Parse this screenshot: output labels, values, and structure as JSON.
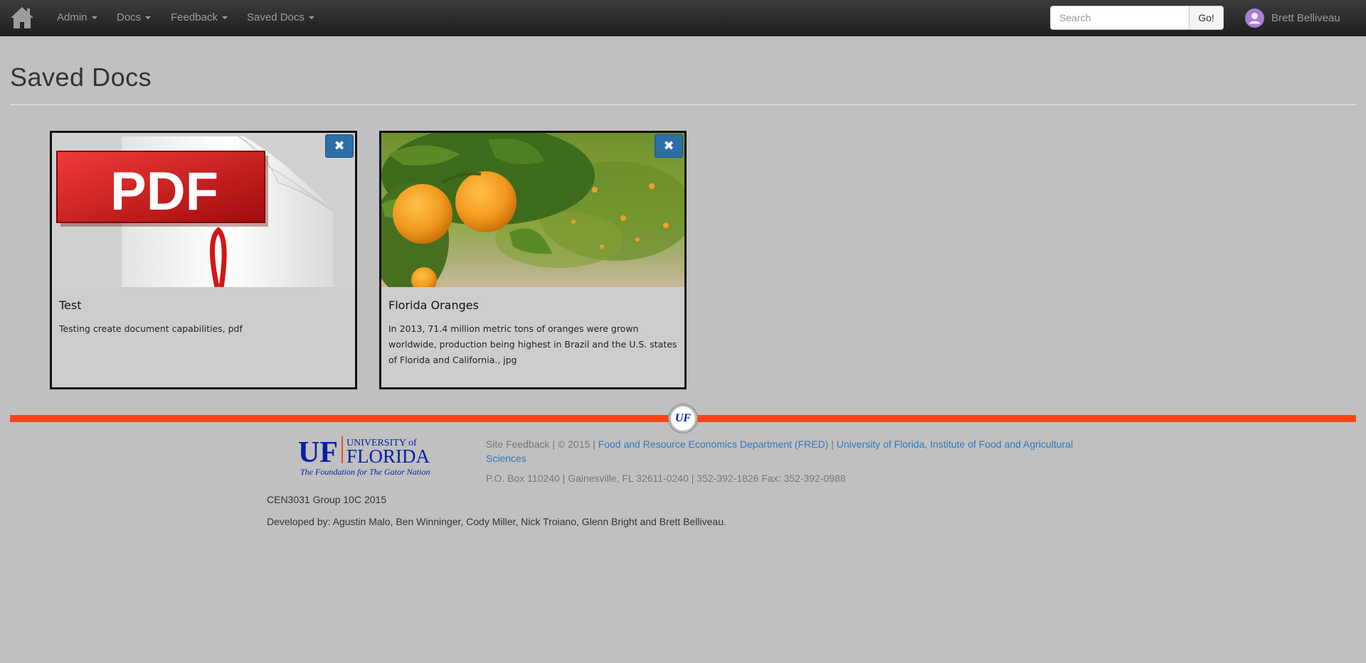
{
  "nav": {
    "menus": [
      {
        "label": "Admin"
      },
      {
        "label": "Docs"
      },
      {
        "label": "Feedback"
      },
      {
        "label": "Saved Docs"
      }
    ],
    "search_placeholder": "Search",
    "search_button": "Go!",
    "user_name": "Brett Belliveau"
  },
  "page": {
    "title": "Saved Docs"
  },
  "cards": [
    {
      "title": "Test",
      "description": "Testing create document capabilities, pdf",
      "thumbnail_icon": "pdf-document-icon",
      "thumbnail_text": "PDF",
      "remove_icon": "✖"
    },
    {
      "title": "Florida Oranges",
      "description": "In 2013, 71.4 million metric tons of oranges were grown worldwide, production being highest in Brazil and the U.S. states of Florida and California., jpg",
      "thumbnail_icon": "oranges-photo",
      "remove_icon": "✖"
    }
  ],
  "footer": {
    "seal_text": "UF",
    "logo_text": {
      "uf": "UF",
      "university_of": "UNIVERSITY of",
      "florida": "FLORIDA",
      "tagline": "The Foundation for The Gator Nation"
    },
    "site_feedback": "Site Feedback | © 2015 |",
    "link_fred": "Food and Resource Economics Department (FRED)",
    "separator": "|",
    "link_ifas": "University of Florida, Institute of Food and Agricultural Sciences",
    "address": "P.O. Box 110240 | Gainesville, FL 32611-0240 | 352-392-1826 Fax: 352-392-0988",
    "group": "CEN3031 Group 10C 2015",
    "developers": "Developed by: Agustin Malo, Ben Winninger, Cody Miller, Nick Troiano, Glenn Bright and Brett Belliveau."
  },
  "colors": {
    "navbar": "#222222",
    "page_background": "#c0c0c0",
    "accent_orange": "#fa4616",
    "uf_blue": "#0021a5",
    "button_blue": "#2c6fa8",
    "link": "#337ab7"
  }
}
